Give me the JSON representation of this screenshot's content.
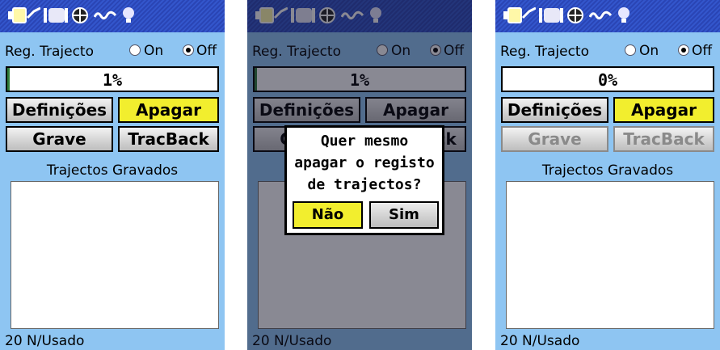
{
  "screens": [
    {
      "reg_label": "Reg. Trajecto",
      "on_label": "On",
      "off_label": "Off",
      "selected": "off",
      "progress_text": "1%",
      "progress_value": 0.01,
      "buttons": {
        "definicoes": "Definições",
        "apagar": "Apagar",
        "grave": "Grave",
        "tracback": "TracBack"
      },
      "section_title": "Trajectos Gravados",
      "footer": "20 N/Usado"
    },
    {
      "reg_label": "Reg. Trajecto",
      "on_label": "On",
      "off_label": "Off",
      "selected": "off",
      "progress_text": "1%",
      "progress_value": 0.01,
      "buttons": {
        "definicoes": "Definições",
        "apagar": "Apagar",
        "grave": "Grave",
        "tracback": "TracBack"
      },
      "section_title": "Trajectos Gravados",
      "footer": "20 N/Usado",
      "dialog": {
        "lines": [
          "Quer mesmo",
          "apagar o registo",
          "de trajectos?"
        ],
        "no_label": "Não",
        "yes_label": "Sim"
      }
    },
    {
      "reg_label": "Reg. Trajecto",
      "on_label": "On",
      "off_label": "Off",
      "selected": "off",
      "progress_text": "0%",
      "progress_value": 0,
      "buttons": {
        "definicoes": "Definições",
        "apagar": "Apagar",
        "grave": "Grave",
        "tracback": "TracBack"
      },
      "section_title": "Trajectos Gravados",
      "footer": "20 N/Usado"
    }
  ],
  "top_icons": [
    "battery-icon",
    "satellite-strength-icon",
    "compass-icon",
    "track-icon",
    "backlight-icon"
  ],
  "colors": {
    "body_bg": "#8ec5f2",
    "topbar": "#3356cc",
    "highlight": "#f2ee2e",
    "progress_fill": "#2f7d3a"
  }
}
